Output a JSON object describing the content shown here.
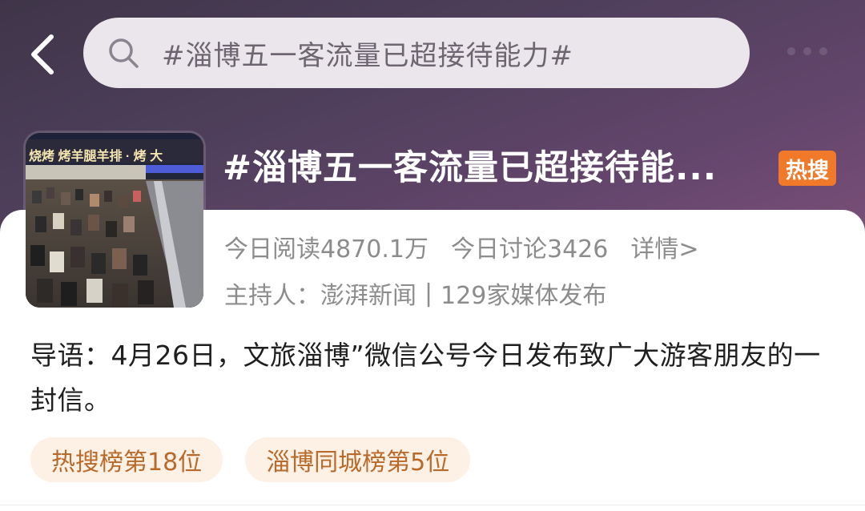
{
  "header": {
    "search_text": "#淄博五一客流量已超接待能力#"
  },
  "topic": {
    "title": "#淄博五一客流量已超接待能...",
    "badge": "热搜",
    "stats": {
      "reads": "今日阅读4870.1万",
      "discussions": "今日讨论3426",
      "details_link": "详情>"
    },
    "host": {
      "host_label": "主持人：澎湃新闻",
      "separator": "|",
      "media_count": "129家媒体发布"
    },
    "thumbnail": {
      "sign_text": "烧烤 烤羊腿羊排 · 烤 大"
    }
  },
  "intro": "导语：4月26日，文旅淄博”微信公号今日发布致广大游客朋友的一封信。",
  "tags": [
    {
      "label": "热搜榜第18位"
    },
    {
      "label": "淄博同城榜第5位"
    }
  ],
  "colors": {
    "badge": "#f07a2a",
    "tag_bg": "#fdf0e4",
    "tag_text": "#b86a2a",
    "header_bg": "#4f3f5c"
  }
}
